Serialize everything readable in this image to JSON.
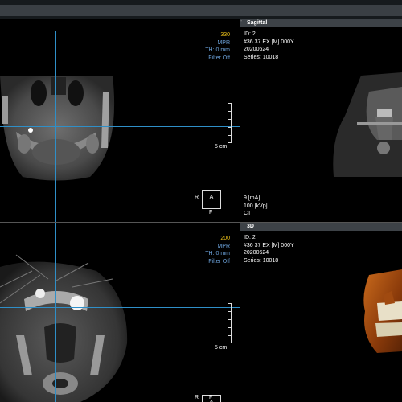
{
  "topbar": {},
  "viewports": {
    "coronal": {
      "slice": "330",
      "mode": "MPR",
      "thickness": "TH: 0 mm",
      "filter": "Filter Off",
      "scale_label": "5 cm",
      "orient": {
        "left": "R",
        "center": "A",
        "bottom": "F"
      }
    },
    "sagittal": {
      "title": "Sagittal",
      "id": "ID: 2",
      "patient": "#36 37 EX [M] 000Y",
      "date": "20200624",
      "series": "Series: 10018",
      "ma": "9 [mA]",
      "kvp": "100 [kVp]",
      "modality": "CT"
    },
    "axial": {
      "slice": "200",
      "mode": "MPR",
      "thickness": "TH: 0 mm",
      "filter": "Filter Off",
      "scale_label": "5 cm",
      "orient": {
        "left": "R",
        "center": "A",
        "bottom": "F"
      }
    },
    "threed": {
      "title": "3D",
      "id": "ID: 2",
      "patient": "#36 37 EX [M] 000Y",
      "date": "20200624",
      "series": "Series: 10018"
    }
  },
  "colors": {
    "crosshair": "#2f8fc8",
    "slice_number": "#f0c419",
    "info_blue": "#6aa0d8",
    "header_bg": "#3d4247"
  }
}
